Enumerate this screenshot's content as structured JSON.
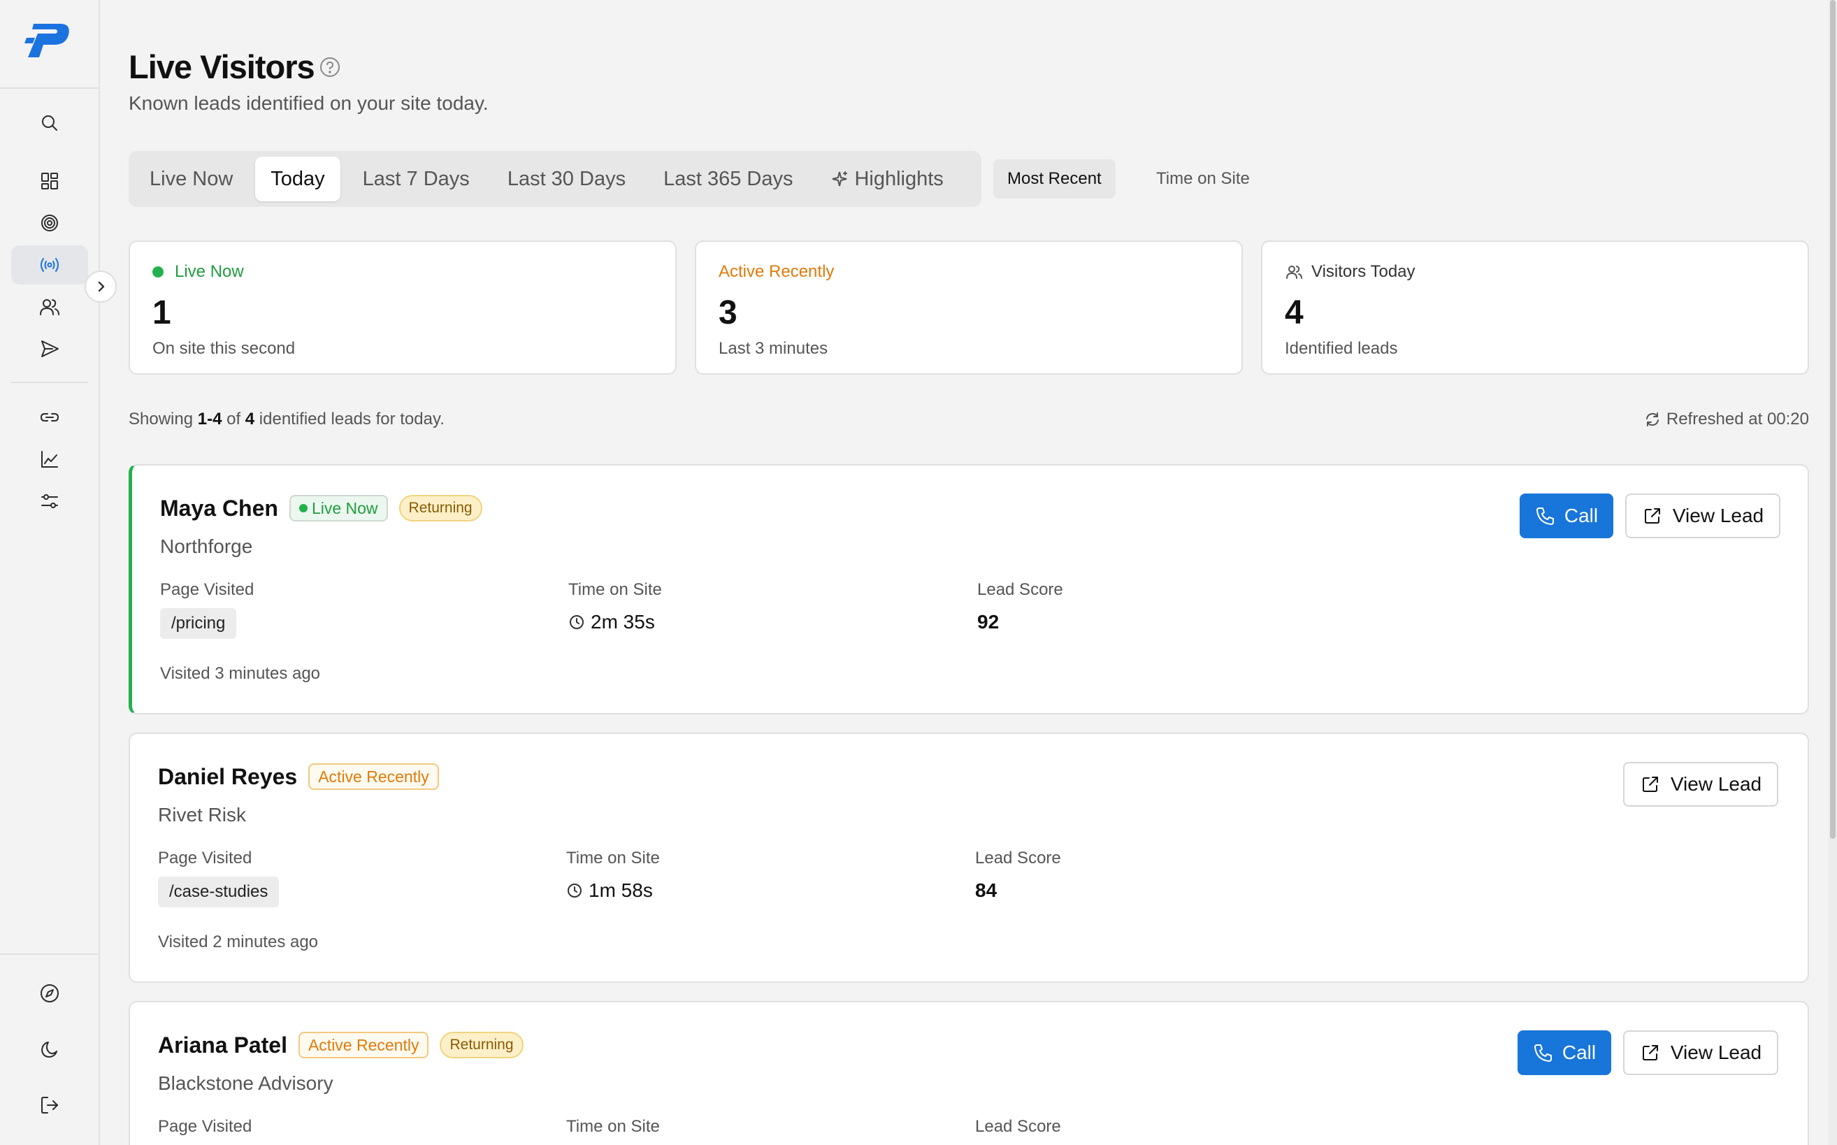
{
  "sidebar": {
    "logo_icon": "brand-p-logo",
    "items": [
      {
        "icon": "search-icon"
      },
      {
        "icon": "dashboard-icon"
      },
      {
        "icon": "target-icon"
      },
      {
        "icon": "broadcast-icon",
        "active": true
      },
      {
        "icon": "users-icon"
      },
      {
        "icon": "send-icon"
      },
      {
        "icon": "link-icon"
      },
      {
        "icon": "chart-line-icon"
      },
      {
        "icon": "sliders-icon"
      },
      {
        "icon": "compass-icon"
      },
      {
        "icon": "moon-icon"
      },
      {
        "icon": "logout-icon"
      }
    ]
  },
  "header": {
    "title": "Live Visitors",
    "subtitle": "Known leads identified on your site today."
  },
  "tabs": [
    {
      "label": "Live Now"
    },
    {
      "label": "Today",
      "active": true
    },
    {
      "label": "Last 7 Days"
    },
    {
      "label": "Last 30 Days"
    },
    {
      "label": "Last 365 Days"
    },
    {
      "label": "Highlights",
      "icon": "sparkle-icon"
    }
  ],
  "sort": {
    "most_recent": "Most Recent",
    "time_on_site": "Time on Site",
    "selected": "Most Recent"
  },
  "stats": {
    "live": {
      "label": "Live Now",
      "value": "1",
      "sub": "On site this second",
      "color": "#1f9d3f"
    },
    "active": {
      "label": "Active Recently",
      "value": "3",
      "sub": "Last 3 minutes",
      "color": "#e07b0a"
    },
    "visitors": {
      "label": "Visitors Today",
      "value": "4",
      "sub": "Identified leads"
    }
  },
  "summary": {
    "pre": "Showing ",
    "range": "1-4",
    "mid": " of ",
    "total": "4",
    "post": " identified leads for today.",
    "refreshed": "Refreshed at 00:20"
  },
  "labels": {
    "page_visited": "Page Visited",
    "time_on_site": "Time on Site",
    "lead_score": "Lead Score",
    "call": "Call",
    "view_lead": "View Lead"
  },
  "leads": [
    {
      "name": "Maya Chen",
      "status": "Live Now",
      "returning": "Returning",
      "company": "Northforge",
      "page": "/pricing",
      "time": "2m 35s",
      "score": "92",
      "visited": "Visited 3 minutes ago"
    },
    {
      "name": "Daniel Reyes",
      "status": "Active Recently",
      "company": "Rivet Risk",
      "page": "/case-studies",
      "time": "1m 58s",
      "score": "84",
      "visited": "Visited 2 minutes ago"
    },
    {
      "name": "Ariana Patel",
      "status": "Active Recently",
      "returning": "Returning",
      "company": "Blackstone Advisory"
    }
  ],
  "colors": {
    "accent": "#1875d9",
    "live_green": "#22b14c",
    "active_orange": "#e07b0a"
  }
}
